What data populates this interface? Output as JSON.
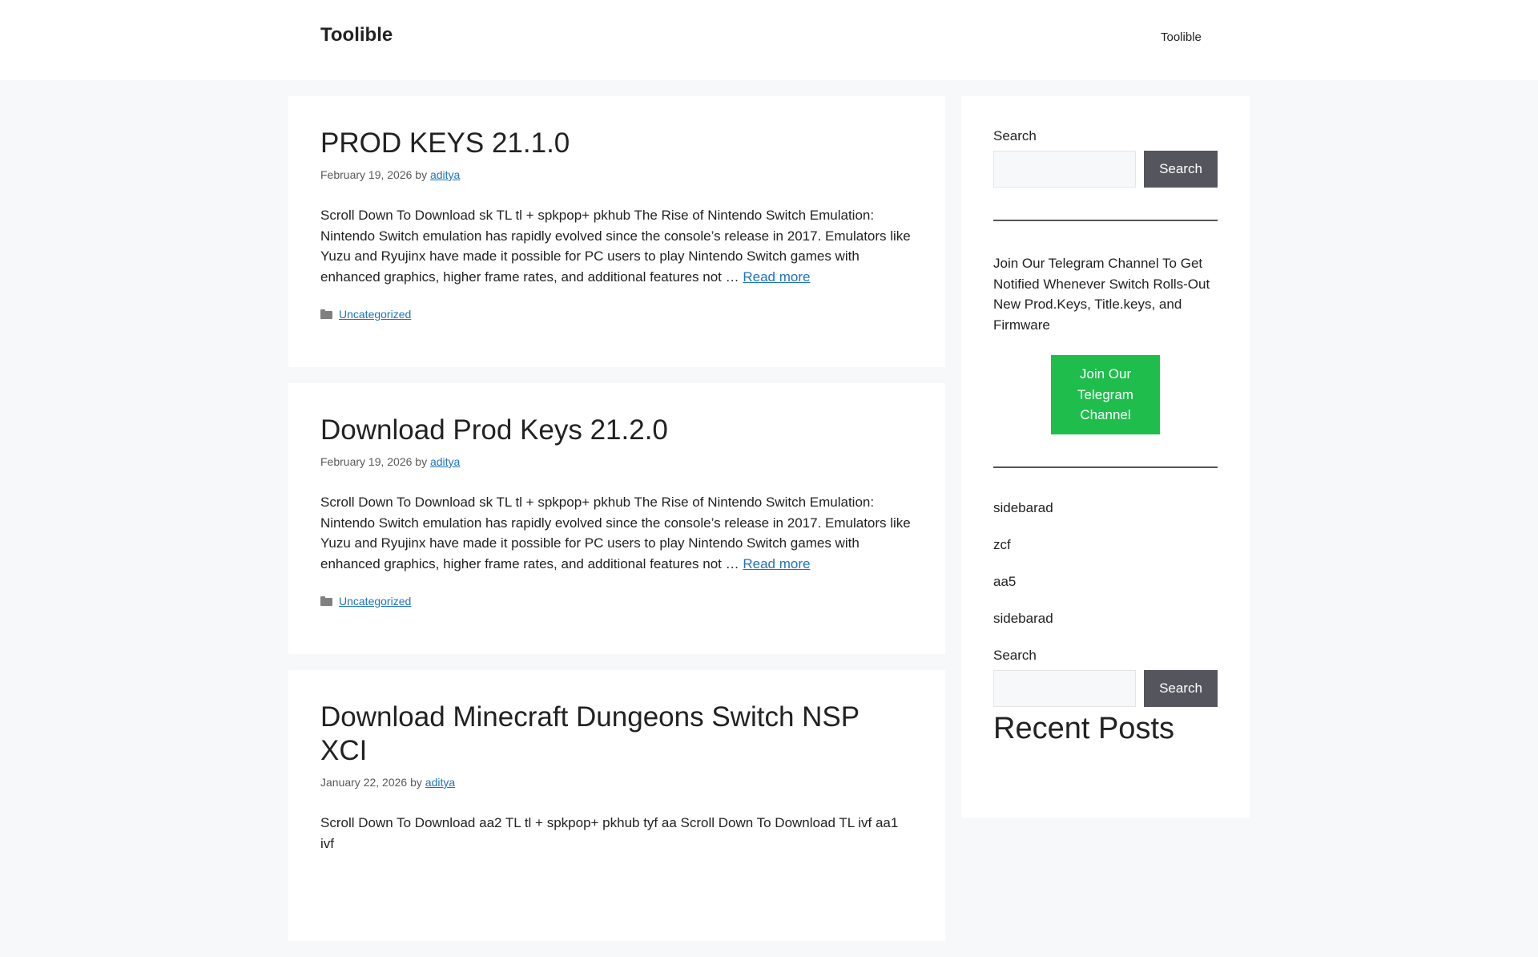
{
  "header": {
    "site_title": "Toolible",
    "nav": [
      "Toolible"
    ]
  },
  "posts": [
    {
      "title": "PROD KEYS 21.1.0",
      "date": "February 19, 2026",
      "by": "by",
      "author": "aditya",
      "excerpt": "Scroll Down To Download sk TL tl + spkpop+ pkhub The Rise of Nintendo Switch Emulation: Nintendo Switch emulation has rapidly evolved since the console’s release in 2017. Emulators like Yuzu and Ryujinx have made it possible for PC users to play Nintendo Switch games with enhanced graphics, higher frame rates, and additional features not …",
      "read_more": "Read more",
      "category": "Uncategorized"
    },
    {
      "title": "Download Prod Keys 21.2.0",
      "date": "February 19, 2026",
      "by": "by",
      "author": "aditya",
      "excerpt": "Scroll Down To Download sk TL tl + spkpop+ pkhub The Rise of Nintendo Switch Emulation: Nintendo Switch emulation has rapidly evolved since the console’s release in 2017. Emulators like Yuzu and Ryujinx have made it possible for PC users to play Nintendo Switch games with enhanced graphics, higher frame rates, and additional features not …",
      "read_more": "Read more",
      "category": "Uncategorized"
    },
    {
      "title": "Download Minecraft Dungeons Switch NSP XCI",
      "date": "January 22, 2026",
      "by": "by",
      "author": "aditya",
      "excerpt": "Scroll Down To Download aa2 TL tl + spkpop+ pkhub tyf aa Scroll Down To Download TL ivf aa1 ivf",
      "read_more": "",
      "category": ""
    }
  ],
  "sidebar": {
    "search1": {
      "label": "Search",
      "button": "Search",
      "value": ""
    },
    "promo_text": "Join Our Telegram Channel To Get Notified Whenever Switch Rolls-Out New Prod.Keys, Title.keys, and Firmware",
    "telegram_button": "Join Our Telegram Channel",
    "items": [
      "sidebarad",
      "zcf",
      "aa5",
      "sidebarad"
    ],
    "search2": {
      "label": "Search",
      "button": "Search",
      "value": ""
    },
    "recent_heading": "Recent Posts"
  },
  "colors": {
    "accent_link": "#1e73be",
    "button": "#55555e",
    "telegram": "#1fbd4c",
    "page_bg": "#f7f8f9"
  }
}
